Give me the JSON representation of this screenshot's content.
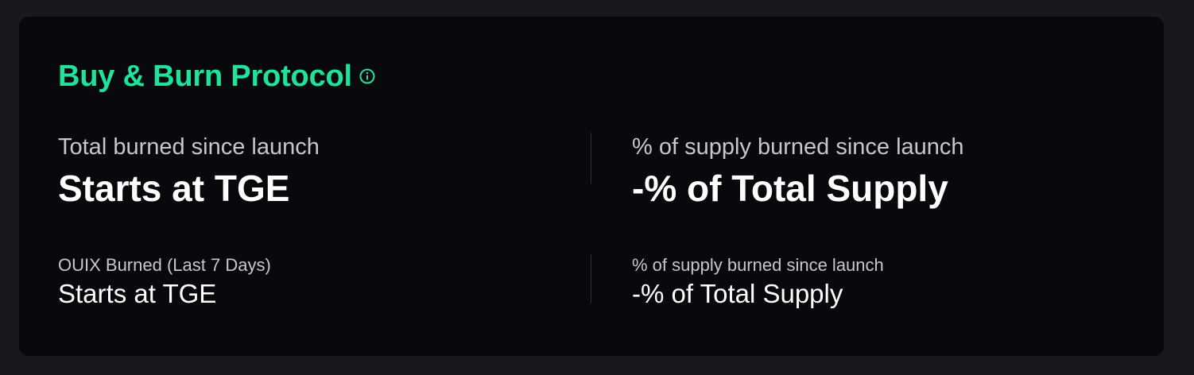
{
  "card": {
    "title": "Buy & Burn Protocol",
    "info_icon": "info-circle-icon",
    "accent_color": "#1fe39a",
    "primary_stats": {
      "total_burned": {
        "label": "Total burned since launch",
        "value": "Starts at TGE"
      },
      "supply_burned": {
        "label": "% of supply burned since launch",
        "value": "-% of Total Supply"
      }
    },
    "secondary_stats": {
      "burned_7d": {
        "label": "OUIX Burned (Last 7 Days)",
        "value": "Starts at TGE"
      },
      "supply_burned": {
        "label": "% of supply burned since launch",
        "value": "-% of Total Supply"
      }
    }
  }
}
